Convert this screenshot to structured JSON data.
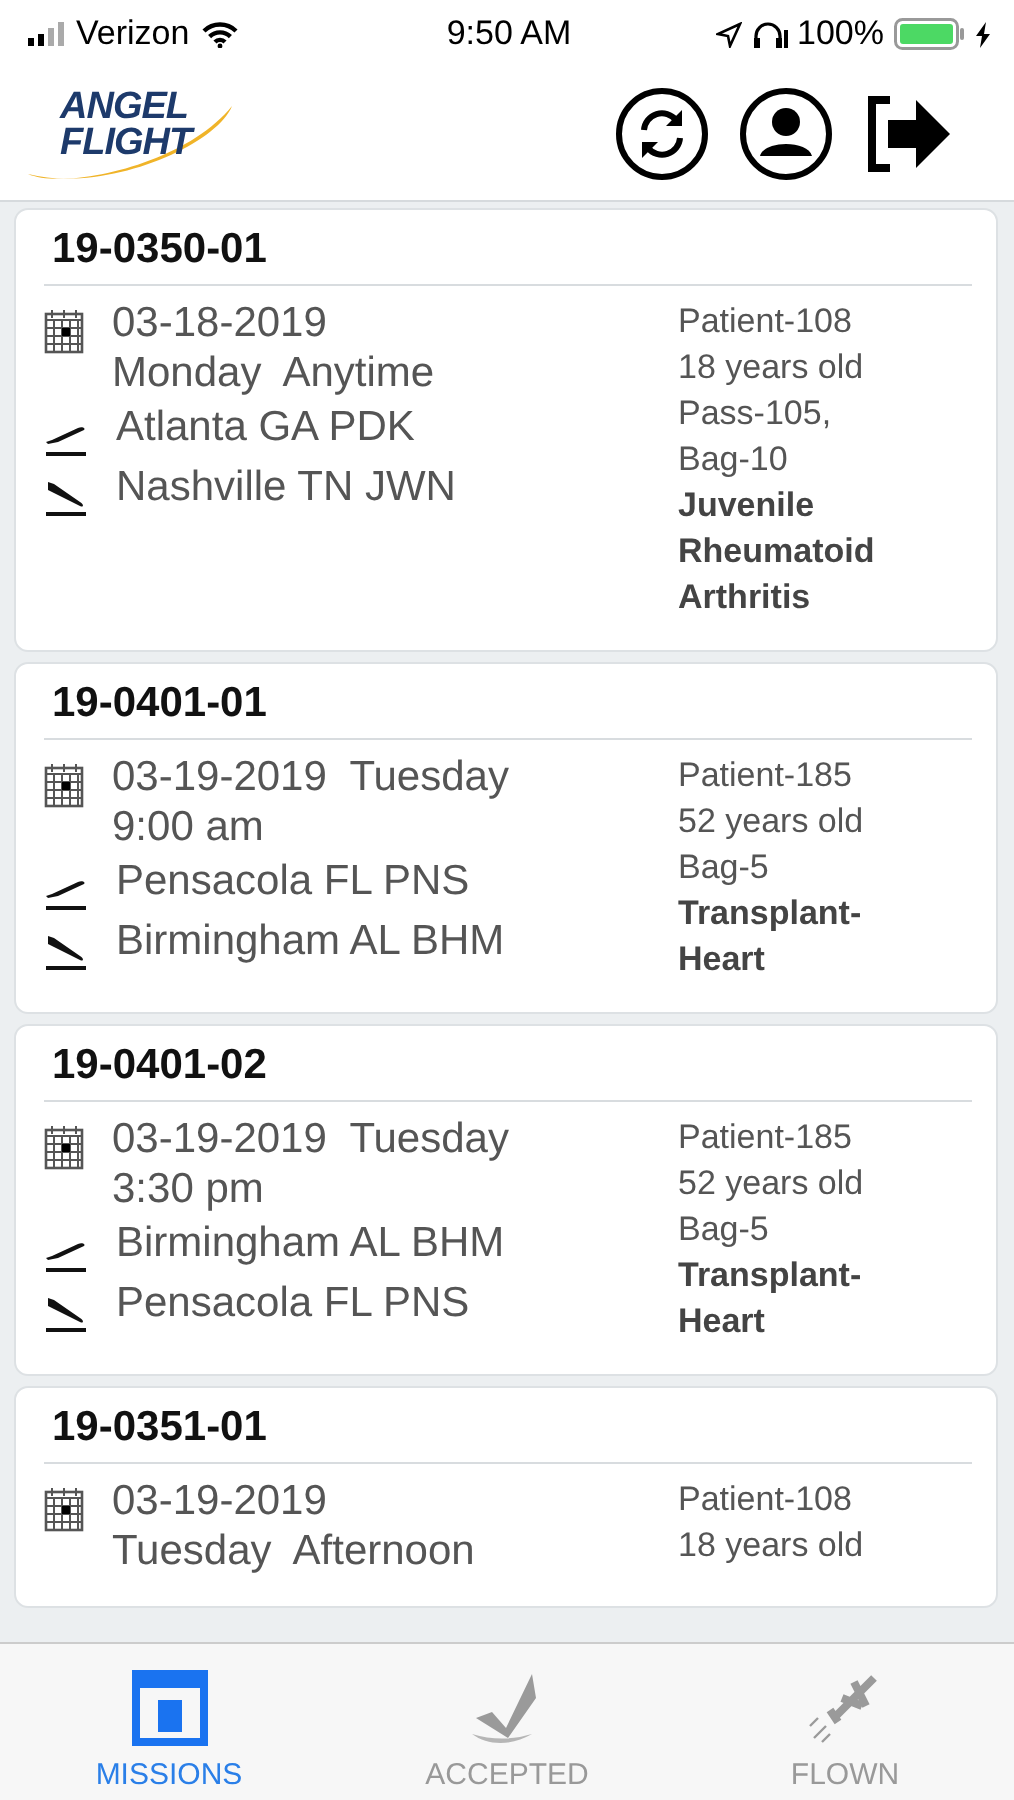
{
  "status_bar": {
    "carrier": "Verizon",
    "time": "9:50 AM",
    "battery": "100%"
  },
  "header": {
    "logo": [
      "ANGEL",
      "FLIGHT"
    ]
  },
  "missions": [
    {
      "id": "19-0350-01",
      "date_lines": [
        "03-18-2019",
        "Monday  Anytime"
      ],
      "from": "Atlanta GA PDK",
      "to": "Nashville TN JWN",
      "patient": "Patient-108",
      "age": "18 years old",
      "load": "Pass-105, Bag-10",
      "diagnosis": "Juvenile Rheumatoid Arthritis"
    },
    {
      "id": "19-0401-01",
      "date_lines": [
        "03-19-2019  Tuesday",
        "9:00 am"
      ],
      "from": "Pensacola FL PNS",
      "to": "Birmingham AL BHM",
      "patient": "Patient-185",
      "age": "52 years old",
      "load": "Bag-5",
      "diagnosis": "Transplant-Heart"
    },
    {
      "id": "19-0401-02",
      "date_lines": [
        "03-19-2019  Tuesday",
        "3:30 pm"
      ],
      "from": "Birmingham AL BHM",
      "to": "Pensacola FL PNS",
      "patient": "Patient-185",
      "age": "52 years old",
      "load": "Bag-5",
      "diagnosis": "Transplant-Heart"
    },
    {
      "id": "19-0351-01",
      "date_lines": [
        "03-19-2019",
        "Tuesday  Afternoon"
      ],
      "patient": "Patient-108",
      "age": "18 years old"
    }
  ],
  "tabs": [
    {
      "label": "MISSIONS",
      "kind": "missions",
      "selected": true
    },
    {
      "label": "ACCEPTED",
      "kind": "accepted",
      "selected": false
    },
    {
      "label": "FLOWN",
      "kind": "flown",
      "selected": false
    }
  ]
}
